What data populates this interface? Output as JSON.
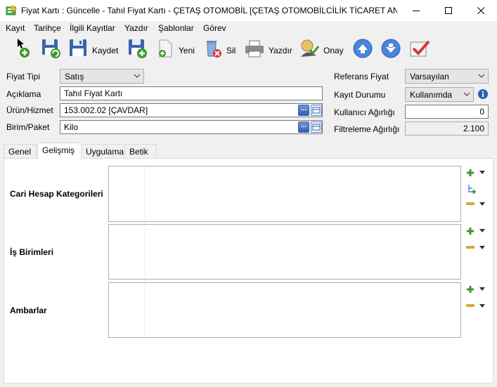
{
  "window": {
    "title": "Fiyat Kartı : Güncelle - Tahıl Fiyat Kartı - ÇETAŞ OTOMOBİL [ÇETAŞ OTOMOBİLCİLİK TİCARET ANONİ...",
    "icon": "price-card-icon",
    "controls": [
      "minimize-icon",
      "maximize-icon",
      "close-icon"
    ]
  },
  "menu": [
    "Kayıt",
    "Tarihçe",
    "İlgili Kayıtlar",
    "Yazdır",
    "Şablonlar",
    "Görev"
  ],
  "toolbar": {
    "new_icon": "new-record-icon",
    "refresh_icon": "save-refresh-icon",
    "save_label": "Kaydet",
    "new_label": "Yeni",
    "delete_label": "Sil",
    "print_label": "Yazdır",
    "approve_label": "Onay",
    "nav_up_icon": "arrow-up-icon",
    "nav_down_icon": "arrow-down-icon",
    "check_icon": "checklist-icon"
  },
  "form": {
    "fiyat_tipi_label": "Fiyat Tipi",
    "fiyat_tipi_value": "Satış",
    "aciklama_label": "Açıklama",
    "aciklama_value": "Tahıl Fiyat Kartı",
    "urun_label": "Ürün/Hizmet",
    "urun_value": "153.002.02 [ÇAVDAR]",
    "birim_label": "Birim/Paket",
    "birim_value": "Kilo",
    "lookup_button": "...",
    "referans_label": "Referans Fiyat",
    "referans_value": "Varsayılan",
    "kayit_label": "Kayıt Durumu",
    "kayit_value": "Kullanımda",
    "kullanici_label": "Kullanıcı Ağırlığı",
    "kullanici_value": "0",
    "filtre_label": "Filtreleme Ağırlığı",
    "filtre_value": "2.100"
  },
  "tabs": [
    "Genel",
    "Gelişmiş",
    "Uygulama",
    "Betik"
  ],
  "active_tab": "Gelişmiş",
  "sections": [
    {
      "label": "Cari Hesap Kategorileri"
    },
    {
      "label": "İş Birimleri"
    },
    {
      "label": "Ambarlar"
    }
  ],
  "colors": {
    "accent_blue": "#2f5fb3",
    "add_green": "#3a9a2a",
    "remove_gold": "#d9a441",
    "delete_red": "#d23b3b"
  }
}
